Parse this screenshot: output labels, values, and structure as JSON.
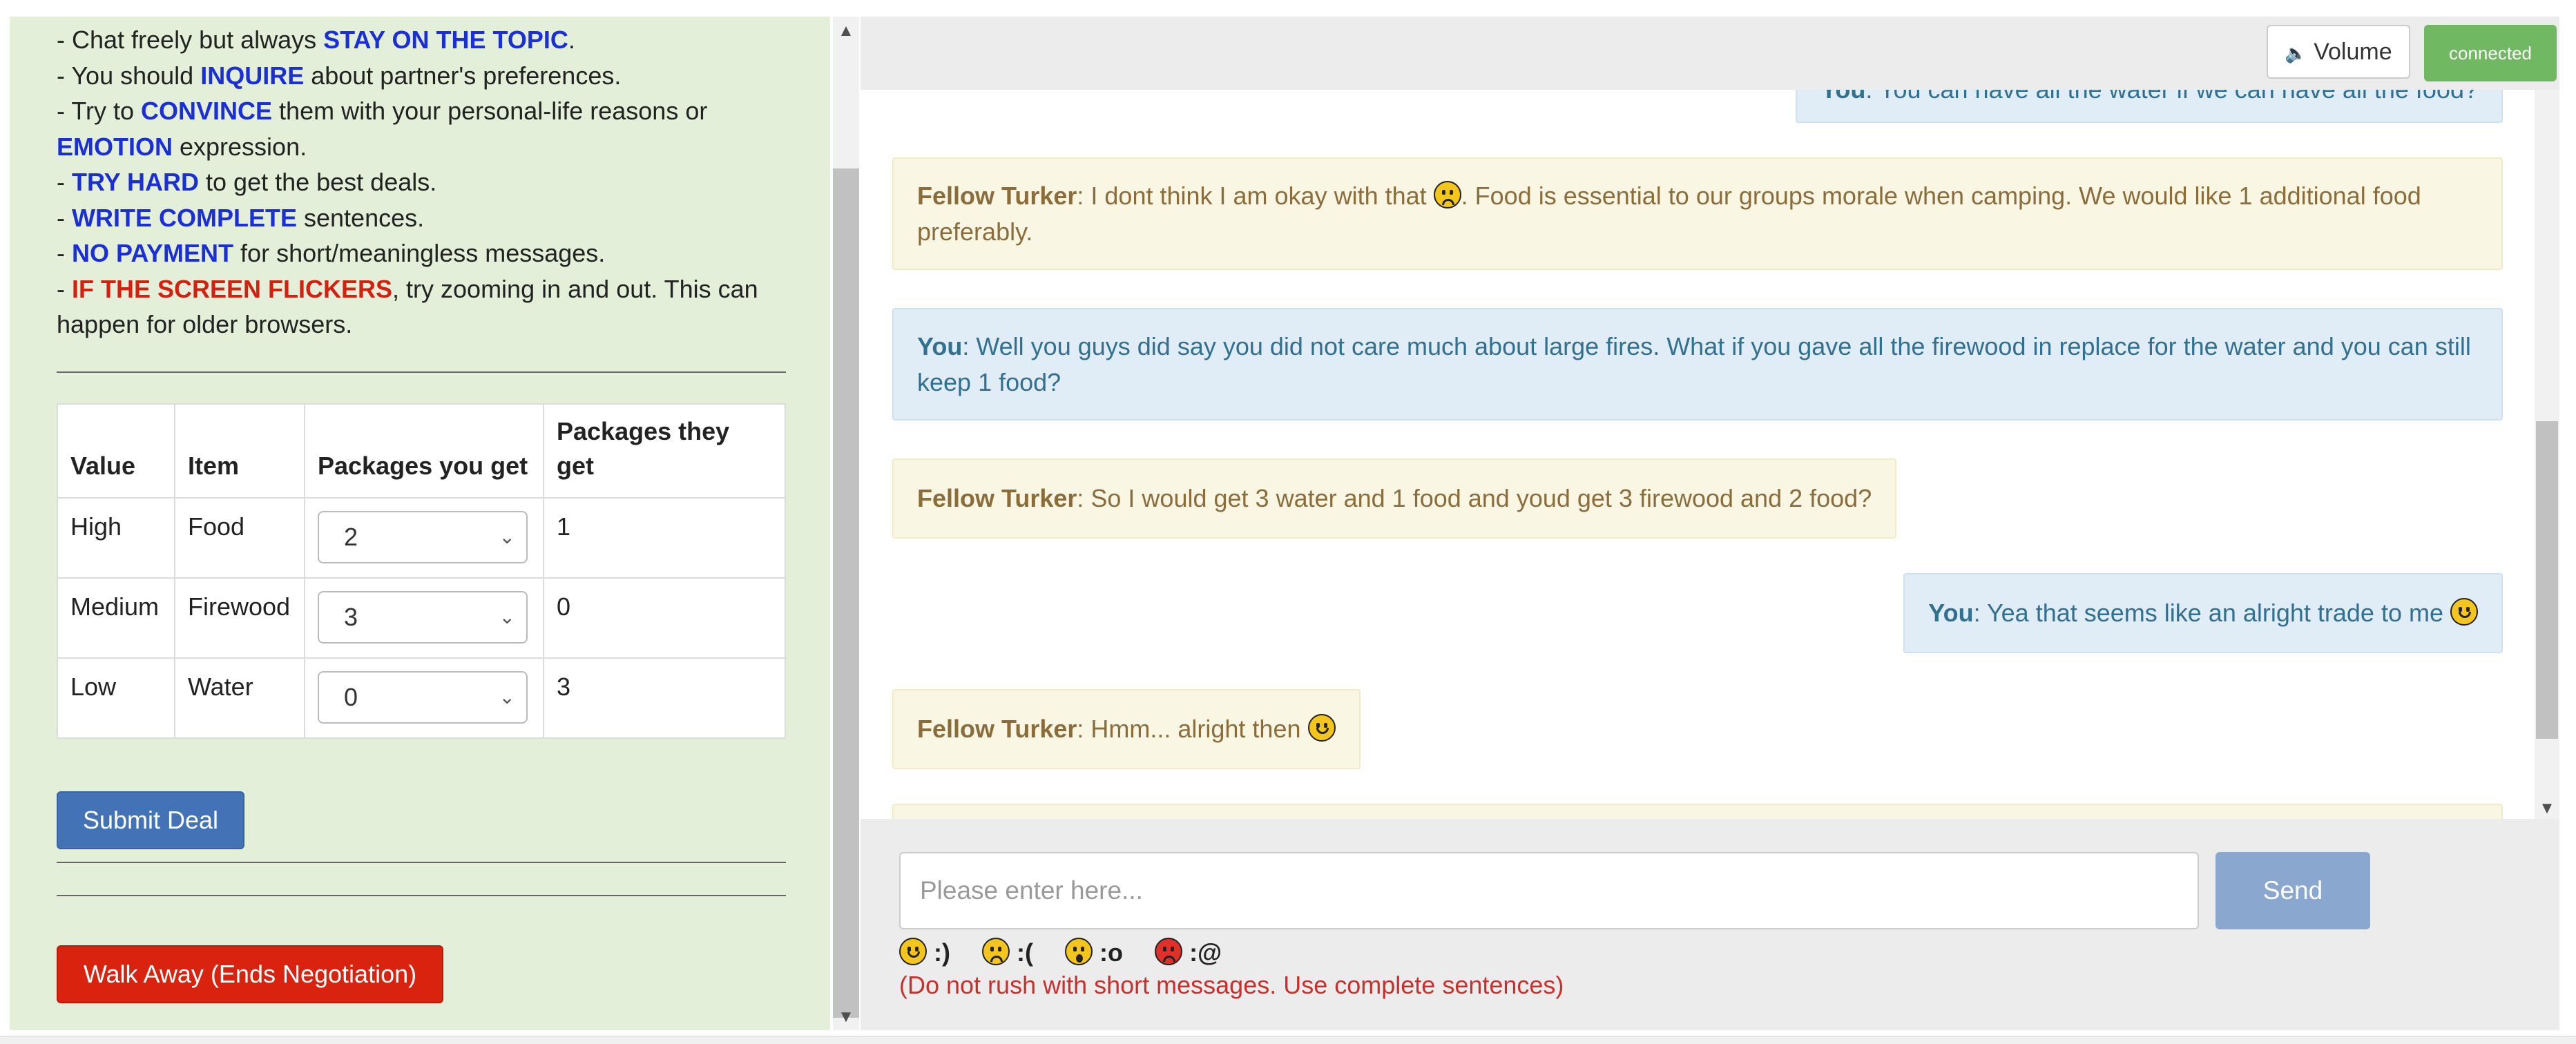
{
  "instructions": {
    "line1": {
      "pre": "- Chat freely but always ",
      "em": "STAY ON THE TOPIC",
      "post": "."
    },
    "line2": {
      "pre": "- You should ",
      "em": "INQUIRE",
      "post": " about partner's preferences."
    },
    "line3": {
      "pre": "- Try to ",
      "em": "CONVINCE",
      "post": " them with your personal-life reasons or"
    },
    "line4": {
      "pre": "",
      "em": "EMOTION",
      "post": " expression."
    },
    "line5": {
      "pre": "- ",
      "em": "TRY HARD",
      "post": " to get the best deals."
    },
    "line6": {
      "pre": "- ",
      "em": "WRITE COMPLETE",
      "post": " sentences."
    },
    "line7": {
      "pre": "- ",
      "em": "NO PAYMENT",
      "post": " for short/meaningless messages."
    },
    "line8": {
      "pre": "- ",
      "em": "IF THE SCREEN FLICKERS",
      "post": ", try zooming in and out. This can"
    },
    "line9": "happen for older browsers."
  },
  "deal_table": {
    "headers": [
      "Value",
      "Item",
      "Packages you get",
      "Packages they get"
    ],
    "rows": [
      {
        "value": "High",
        "item": "Food",
        "you_get": "2",
        "they_get": "1"
      },
      {
        "value": "Medium",
        "item": "Firewood",
        "you_get": "3",
        "they_get": "0"
      },
      {
        "value": "Low",
        "item": "Water",
        "you_get": "0",
        "they_get": "3"
      }
    ]
  },
  "buttons": {
    "submit": "Submit Deal",
    "walk_away": "Walk Away (Ends Negotiation)",
    "volume": "Volume",
    "send": "Send"
  },
  "status": {
    "connection": "connected"
  },
  "chat": {
    "messages": [
      {
        "speaker": "You",
        "text": ": You can have all the water if we can have all the food?"
      },
      {
        "speaker": "Fellow Turker",
        "text_a": ": I dont think I am okay with that ",
        "emoji": "sad",
        "text_b": ". Food is essential to our groups morale when camping. We would like 1 additional food",
        "text_c": "preferably."
      },
      {
        "speaker": "You",
        "text_a": ": Well you guys did say you did not care much about large fires. What if you gave all the firewood in replace for the water and you can still",
        "text_b": "keep 1 food?"
      },
      {
        "speaker": "Fellow Turker",
        "text": ": So I would get 3 water and 1 food and youd get 3 firewood and 2 food?"
      },
      {
        "speaker": "You",
        "text": ": Yea that seems like an alright trade to me ",
        "emoji": "happy"
      },
      {
        "speaker": "Fellow Turker",
        "text": ": Hmm... alright then ",
        "emoji": "happy"
      }
    ]
  },
  "input": {
    "placeholder": "Please enter here..."
  },
  "emoji_shortcuts": [
    {
      "icon": "happy",
      "code": ":)"
    },
    {
      "icon": "sad",
      "code": ":("
    },
    {
      "icon": "wow",
      "code": ":o"
    },
    {
      "icon": "angry",
      "code": ":@"
    }
  ],
  "hint": "(Do not rush with short messages. Use complete sentences)",
  "colors": {
    "left_bg": "#e3efd9",
    "emphasis_blue": "#1a2fd6",
    "emphasis_red": "#d4200f",
    "submit": "#4472b6",
    "walk_away": "#d9230f",
    "connected": "#71b862",
    "send": "#8aa7cf"
  }
}
